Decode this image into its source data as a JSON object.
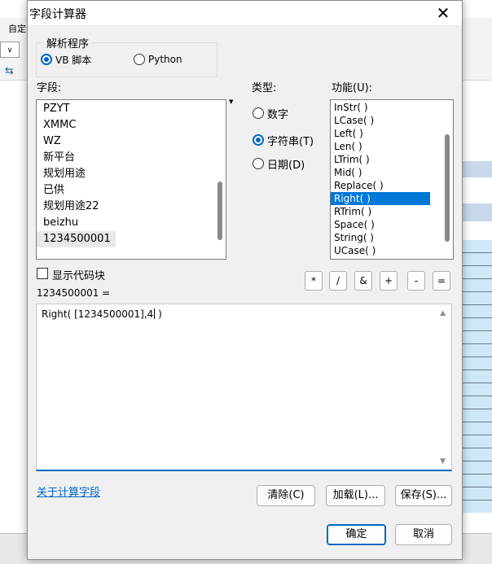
{
  "background": {
    "toolbar_label": "自定",
    "combo_arrow": "∨",
    "tool_icon": "⇆"
  },
  "dialog": {
    "title": "字段计算器",
    "close_glyph": "✕"
  },
  "parser": {
    "group_label": "解析程序",
    "options": [
      {
        "label": "VB 脚本",
        "checked": true
      },
      {
        "label": "Python",
        "checked": false
      }
    ]
  },
  "fields": {
    "label": "字段:",
    "items": [
      "PZYT",
      "XMMC",
      "WZ",
      "新平台",
      "规划用途",
      "已供",
      "规划用途22",
      "beizhu",
      "1234500001"
    ],
    "selected": "1234500001"
  },
  "type": {
    "label": "类型:",
    "options": [
      {
        "label": "数字",
        "checked": false
      },
      {
        "label": "字符串(T)",
        "checked": true
      },
      {
        "label": "日期(D)",
        "checked": false
      }
    ]
  },
  "functions": {
    "label": "功能(U):",
    "items": [
      "InStr( )",
      "LCase( )",
      "Left( )",
      "Len( )",
      "LTrim( )",
      "Mid( )",
      "Replace( )",
      "Right( )",
      "RTrim( )",
      "Space( )",
      "String( )",
      "UCase( )"
    ],
    "selected": "Right( )"
  },
  "show_codeblock": {
    "label": "显示代码块",
    "checked": false
  },
  "operators": [
    "*",
    "/",
    "&",
    "+",
    "-",
    "="
  ],
  "expression": {
    "label": "1234500001 =",
    "value": "Right( [1234500001],4 )",
    "value_before_caret": "Right( [1234500001],4",
    "value_after_caret": " )"
  },
  "footer": {
    "about_link": "关于计算字段",
    "clear_button": "清除(C)",
    "load_button": "加载(L)...",
    "save_button": "保存(S)...",
    "ok_button": "确定",
    "cancel_button": "取消"
  }
}
